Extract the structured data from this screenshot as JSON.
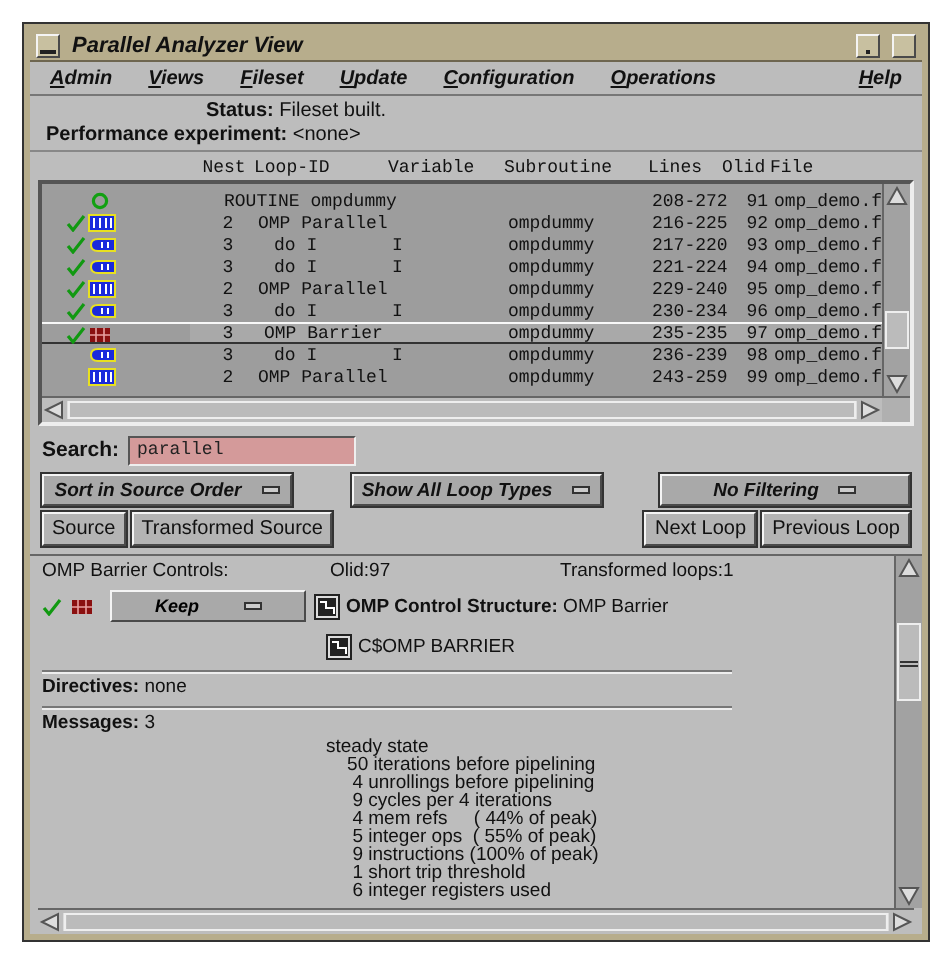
{
  "window": {
    "title": "Parallel Analyzer View"
  },
  "menu": [
    {
      "label": "Admin"
    },
    {
      "label": "Views"
    },
    {
      "label": "Fileset"
    },
    {
      "label": "Update"
    },
    {
      "label": "Configuration"
    },
    {
      "label": "Operations"
    }
  ],
  "help_menu": {
    "label": "Help"
  },
  "status": "**Status:** Fileset built.",
  "experiment": "**Performance experiment:** <none>",
  "table": {
    "columns": [
      "Nest",
      "Loop-ID",
      "Variable",
      "Subroutine",
      "Lines",
      "Olid",
      "File"
    ],
    "rows": [
      {
        "kind": "routine",
        "checked": false,
        "selected": false,
        "loop_id": "ROUTINE ompdummy",
        "lines": "208-272",
        "olid": "91",
        "file": "omp_demo.f"
      },
      {
        "kind": "parallel",
        "checked": true,
        "selected": false,
        "nest": "2",
        "loop_id": "OMP Parallel",
        "subroutine": "ompdummy",
        "lines": "216-225",
        "olid": "92",
        "file": "omp_demo.f"
      },
      {
        "kind": "loop",
        "checked": true,
        "selected": false,
        "nest": "3",
        "loop_id": "do I",
        "variable": "I",
        "subroutine": "ompdummy",
        "lines": "217-220",
        "olid": "93",
        "file": "omp_demo.f"
      },
      {
        "kind": "loop",
        "checked": true,
        "selected": false,
        "nest": "3",
        "loop_id": "do I",
        "variable": "I",
        "subroutine": "ompdummy",
        "lines": "221-224",
        "olid": "94",
        "file": "omp_demo.f"
      },
      {
        "kind": "parallel",
        "checked": true,
        "selected": false,
        "nest": "2",
        "loop_id": "OMP Parallel",
        "subroutine": "ompdummy",
        "lines": "229-240",
        "olid": "95",
        "file": "omp_demo.f"
      },
      {
        "kind": "loop",
        "checked": true,
        "selected": false,
        "nest": "3",
        "loop_id": "do I",
        "variable": "I",
        "subroutine": "ompdummy",
        "lines": "230-234",
        "olid": "96",
        "file": "omp_demo.f"
      },
      {
        "kind": "barrier",
        "checked": true,
        "selected": true,
        "nest": "3",
        "loop_id": "OMP Barrier",
        "subroutine": "ompdummy",
        "lines": "235-235",
        "olid": "97",
        "file": "omp_demo.f"
      },
      {
        "kind": "loop",
        "checked": false,
        "selected": false,
        "nest": "3",
        "loop_id": "do I",
        "variable": "I",
        "subroutine": "ompdummy",
        "lines": "236-239",
        "olid": "98",
        "file": "omp_demo.f"
      },
      {
        "kind": "parallel",
        "checked": false,
        "selected": false,
        "nest": "2",
        "loop_id": "OMP Parallel",
        "subroutine": "ompdummy",
        "lines": "243-259",
        "olid": "99",
        "file": "omp_demo.f"
      }
    ]
  },
  "search": {
    "label": "Search:",
    "value": "parallel"
  },
  "dropdowns": [
    "Sort in Source Order",
    "Show All Loop Types",
    "No Filtering"
  ],
  "left_buttons": [
    "Source",
    "Transformed Source"
  ],
  "right_buttons": [
    "Next Loop",
    "Previous Loop"
  ],
  "detail": {
    "title": "OMP Barrier Controls:",
    "olid": "Olid:97",
    "transformed": "Transformed loops:1",
    "checked": true,
    "kind": "barrier",
    "action": "Keep",
    "structure": "**OMP Control Structure:** OMP Barrier",
    "directive_line": "C$OMP BARRIER",
    "directives": "**Directives:** none",
    "messages_label": "**Messages:** 3",
    "messages": [
      "steady state",
      "    50 iterations before pipelining",
      "     4 unrollings before pipelining",
      "     9 cycles per 4 iterations",
      "     4 mem refs     ( 44% of peak)",
      "     5 integer ops  ( 55% of peak)",
      "     9 instructions (100% of peak)",
      "     1 short trip threshold",
      "     6 integer registers used"
    ]
  }
}
